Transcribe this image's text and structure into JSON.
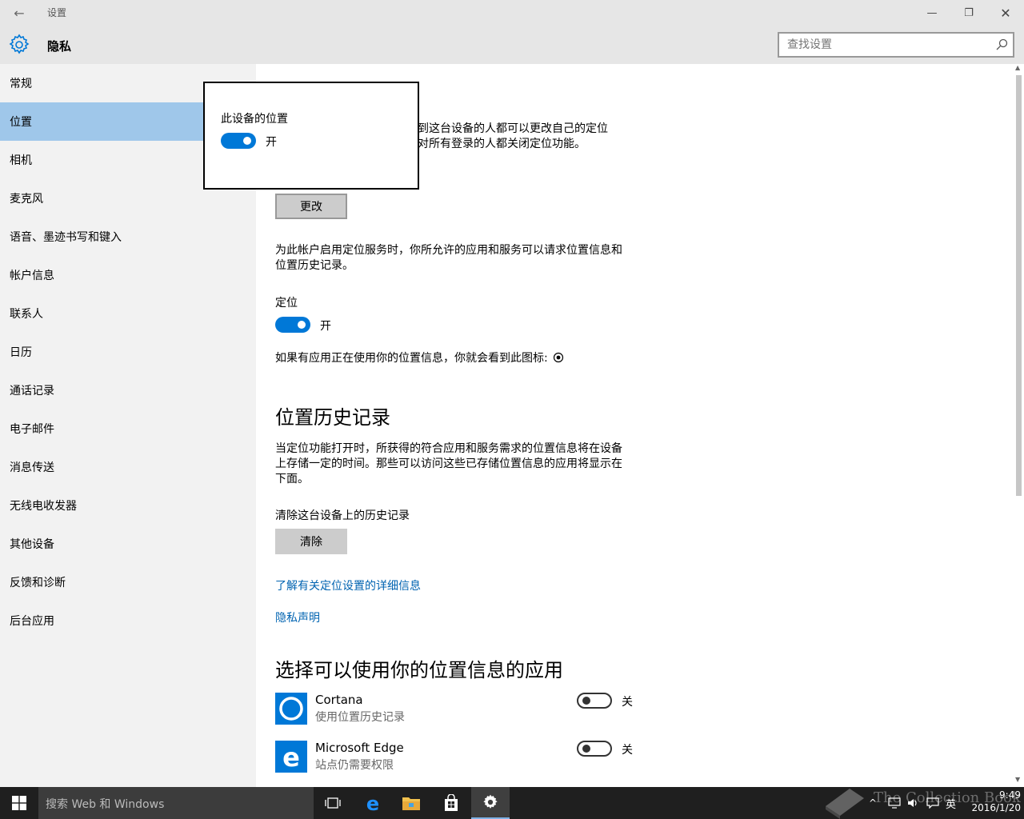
{
  "window": {
    "app_title": "设置",
    "back_glyph": "←",
    "min_glyph": "—",
    "max_glyph": "❐",
    "close_glyph": "✕"
  },
  "header": {
    "page_title": "隐私",
    "search_placeholder": "查找设置"
  },
  "sidebar": {
    "items": [
      {
        "label": "常规",
        "active": false
      },
      {
        "label": "位置",
        "active": true
      },
      {
        "label": "相机",
        "active": false
      },
      {
        "label": "麦克风",
        "active": false
      },
      {
        "label": "语音、墨迹书写和键入",
        "active": false
      },
      {
        "label": "帐户信息",
        "active": false
      },
      {
        "label": "联系人",
        "active": false
      },
      {
        "label": "日历",
        "active": false
      },
      {
        "label": "通话记录",
        "active": false
      },
      {
        "label": "电子邮件",
        "active": false
      },
      {
        "label": "消息传送",
        "active": false
      },
      {
        "label": "无线电收发器",
        "active": false
      },
      {
        "label": "其他设备",
        "active": false
      },
      {
        "label": "反馈和诊断",
        "active": false
      },
      {
        "label": "后台应用",
        "active": false
      }
    ]
  },
  "main": {
    "partial_text_line1": "到这台设备的人都可以更改自己的定位",
    "partial_text_line2": "对所有登录的人都关闭定位功能。",
    "change_button": "更改",
    "account_text": "为此帐户启用定位服务时，你所允许的应用和服务可以请求位置信息和位置历史记录。",
    "location_label": "定位",
    "location_toggle_state": "开",
    "location_toggle_on": true,
    "icon_hint_text": "如果有应用正在使用你的位置信息，你就会看到此图标:",
    "history_heading": "位置历史记录",
    "history_text": "当定位功能打开时，所获得的符合应用和服务需求的位置信息将在设备上存储一定的时间。那些可以访问这些已存储位置信息的应用将显示在下面。",
    "clear_label": "清除这台设备上的历史记录",
    "clear_button": "清除",
    "learn_more_link": "了解有关定位设置的详细信息",
    "privacy_link": "隐私声明",
    "apps_heading": "选择可以使用你的位置信息的应用",
    "apps": [
      {
        "name": "Cortana",
        "subtitle": "使用位置历史记录",
        "toggle_state": "关",
        "toggle_on": false,
        "icon": "cortana-icon",
        "icon_color": "#0078d7"
      },
      {
        "name": "Microsoft Edge",
        "subtitle": "站点仍需要权限",
        "toggle_state": "关",
        "toggle_on": false,
        "icon": "edge-icon",
        "icon_color": "#0078d7"
      }
    ]
  },
  "popup": {
    "title": "此设备的位置",
    "toggle_state": "开",
    "toggle_on": true
  },
  "taskbar": {
    "search_placeholder": "搜索 Web 和 Windows",
    "tray_lang": "英",
    "clock_time": "9:49",
    "clock_date": "2016/1/20",
    "watermark": "The Collection Book"
  },
  "colors": {
    "accent": "#0078d7",
    "sidebar_active": "#9fc7ea",
    "link": "#0063b1",
    "taskbar": "#1f1f1f"
  }
}
